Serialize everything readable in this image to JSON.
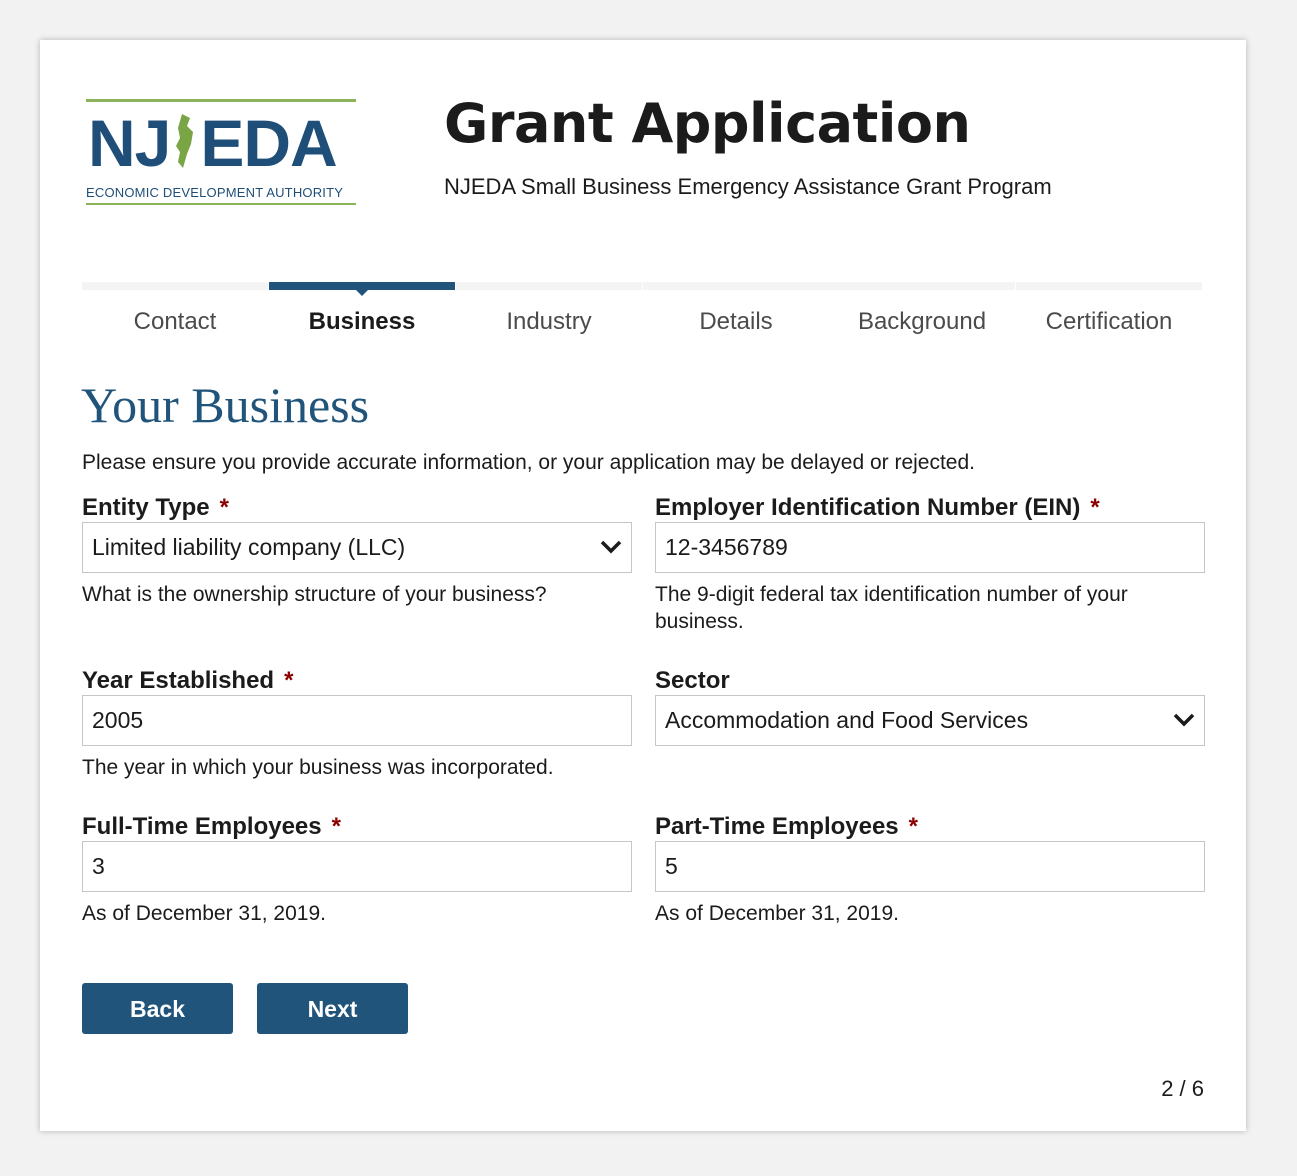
{
  "logo": {
    "text_left": "NJ",
    "text_right": "EDA",
    "subtitle": "ECONOMIC DEVELOPMENT AUTHORITY"
  },
  "header": {
    "title": "Grant Application",
    "subtitle": "NJEDA Small Business Emergency Assistance Grant Program"
  },
  "steps": [
    {
      "label": "Contact",
      "active": false
    },
    {
      "label": "Business",
      "active": true
    },
    {
      "label": "Industry",
      "active": false
    },
    {
      "label": "Details",
      "active": false
    },
    {
      "label": "Background",
      "active": false
    },
    {
      "label": "Certification",
      "active": false
    }
  ],
  "section": {
    "title": "Your Business",
    "intro": "Please ensure you provide accurate information, or your application may be delayed or rejected."
  },
  "fields": {
    "entity_type": {
      "label": "Entity Type",
      "required_mark": "*",
      "value": "Limited liability company (LLC)",
      "help": "What is the ownership structure of your business?"
    },
    "ein": {
      "label": "Employer Identification Number (EIN)",
      "required_mark": "*",
      "value": "12-3456789",
      "help": "The 9-digit federal tax identification number of your business."
    },
    "year_established": {
      "label": "Year Established",
      "required_mark": "*",
      "value": "2005",
      "help": "The year in which your business was incorporated."
    },
    "sector": {
      "label": "Sector",
      "value": "Accommodation and Food Services"
    },
    "full_time": {
      "label": "Full-Time Employees",
      "required_mark": "*",
      "value": "3",
      "help": "As of December 31, 2019."
    },
    "part_time": {
      "label": "Part-Time Employees",
      "required_mark": "*",
      "value": "5",
      "help": "As of December 31, 2019."
    }
  },
  "buttons": {
    "back": "Back",
    "next": "Next"
  },
  "pager": "2 / 6",
  "colors": {
    "accent": "#20547a",
    "required": "#8b0000",
    "logo_green": "#7aa544",
    "logo_blue": "#1f4e79"
  }
}
